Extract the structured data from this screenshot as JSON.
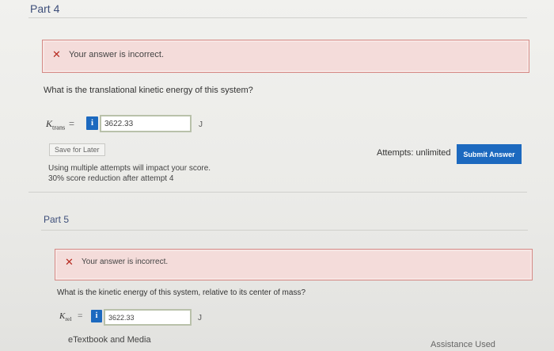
{
  "part4": {
    "title": "Part 4",
    "alert_text": "Your answer is incorrect.",
    "question": "What is the translational kinetic energy of this system?",
    "var_symbol": "K",
    "var_sub": "trans",
    "equals": "=",
    "info_label": "i",
    "answer_value": "3622.33",
    "unit": "J",
    "save_label": "Save for Later",
    "note_line1": "Using multiple attempts will impact your score.",
    "note_line2": "30% score reduction after attempt 4",
    "attempts_text": "Attempts: unlimited",
    "submit_label": "Submit Answer"
  },
  "part5": {
    "title": "Part 5",
    "alert_text": "Your answer is incorrect.",
    "question": "What is the kinetic energy of this system, relative to its center of mass?",
    "var_symbol": "K",
    "var_sub": "rel",
    "equals": "=",
    "info_label": "i",
    "answer_value": "3622.33",
    "unit": "J"
  },
  "footer": {
    "etextbook_label": "eTextbook and Media",
    "assistance_label": "Assistance Used"
  },
  "colors": {
    "accent": "#1c69bf",
    "error": "#b72a20",
    "alert_bg": "#f4dcda"
  }
}
